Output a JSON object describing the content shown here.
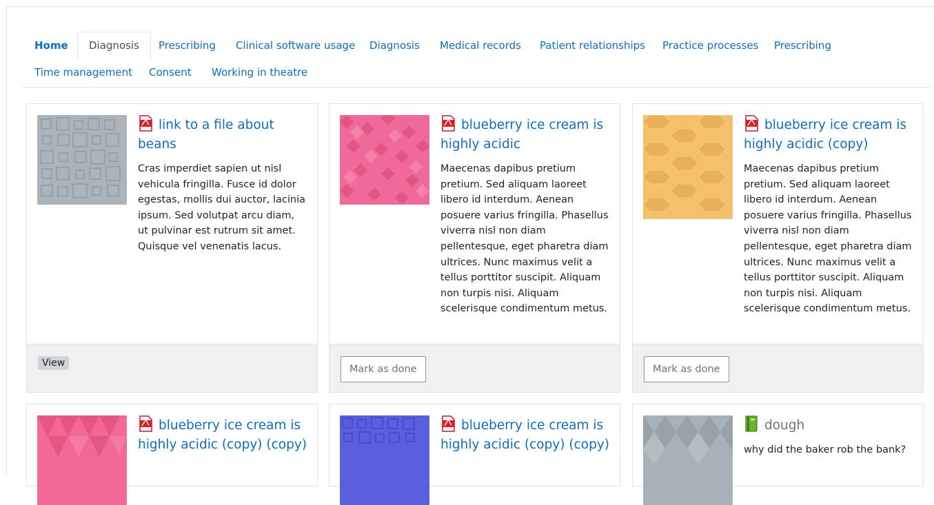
{
  "tabs": [
    {
      "label": "Home",
      "bold": true
    },
    {
      "label": "Diagnosis",
      "active": true
    },
    {
      "label": "Prescribing"
    },
    {
      "label": "Clinical software usage"
    },
    {
      "label": "Diagnosis"
    },
    {
      "label": "Medical records"
    },
    {
      "label": "Patient relationships"
    },
    {
      "label": "Practice processes"
    },
    {
      "label": "Prescribing"
    },
    {
      "label": "Time management"
    },
    {
      "label": "Consent"
    },
    {
      "label": "Working in theatre"
    }
  ],
  "cards": [
    {
      "title": "link to a file about beans",
      "icon": "pdf-icon",
      "body": "Cras imperdiet sapien ut nisl vehicula fringilla. Fusce id dolor egestas, mollis dui auctor, lacinia ipsum. Sed volutpat arcu diam, ut pulvinar est rutrum sit amet. Quisque vel venenatis lacus.",
      "action": "View",
      "thumb_color": "#a9b3b9"
    },
    {
      "title": "blueberry ice cream is highly acidic",
      "icon": "pdf-icon",
      "body": "Maecenas dapibus pretium pretium. Sed aliquam laoreet libero id interdum. Aenean posuere varius fringilla. Phasellus viverra nisl non diam pellentesque, eget pharetra diam ultrices. Nunc maximus velit a tellus porttitor suscipit. Aliquam non turpis nisi. Aliquam scelerisque condimentum metus.",
      "action": "Mark as done",
      "thumb_color": "#ef6a9a"
    },
    {
      "title": "blueberry ice cream is highly acidic (copy)",
      "icon": "pdf-icon",
      "body": "Maecenas dapibus pretium pretium. Sed aliquam laoreet libero id interdum. Aenean posuere varius fringilla. Phasellus viverra nisl non diam pellentesque, eget pharetra diam ultrices. Nunc maximus velit a tellus porttitor suscipit. Aliquam non turpis nisi. Aliquam scelerisque condimentum metus.",
      "action": "Mark as done",
      "thumb_color": "#f5c06a"
    },
    {
      "title": "blueberry ice cream is highly acidic (copy) (copy)",
      "icon": "pdf-icon",
      "thumb_color": "#f06893"
    },
    {
      "title": "blueberry ice cream is highly acidic (copy) (copy)",
      "icon": "pdf-icon",
      "thumb_color": "#5c5ee0"
    },
    {
      "title": "dough",
      "icon": "book-icon",
      "body": "why did the baker rob the bank?",
      "thumb_color": "#a7b1b7"
    }
  ]
}
